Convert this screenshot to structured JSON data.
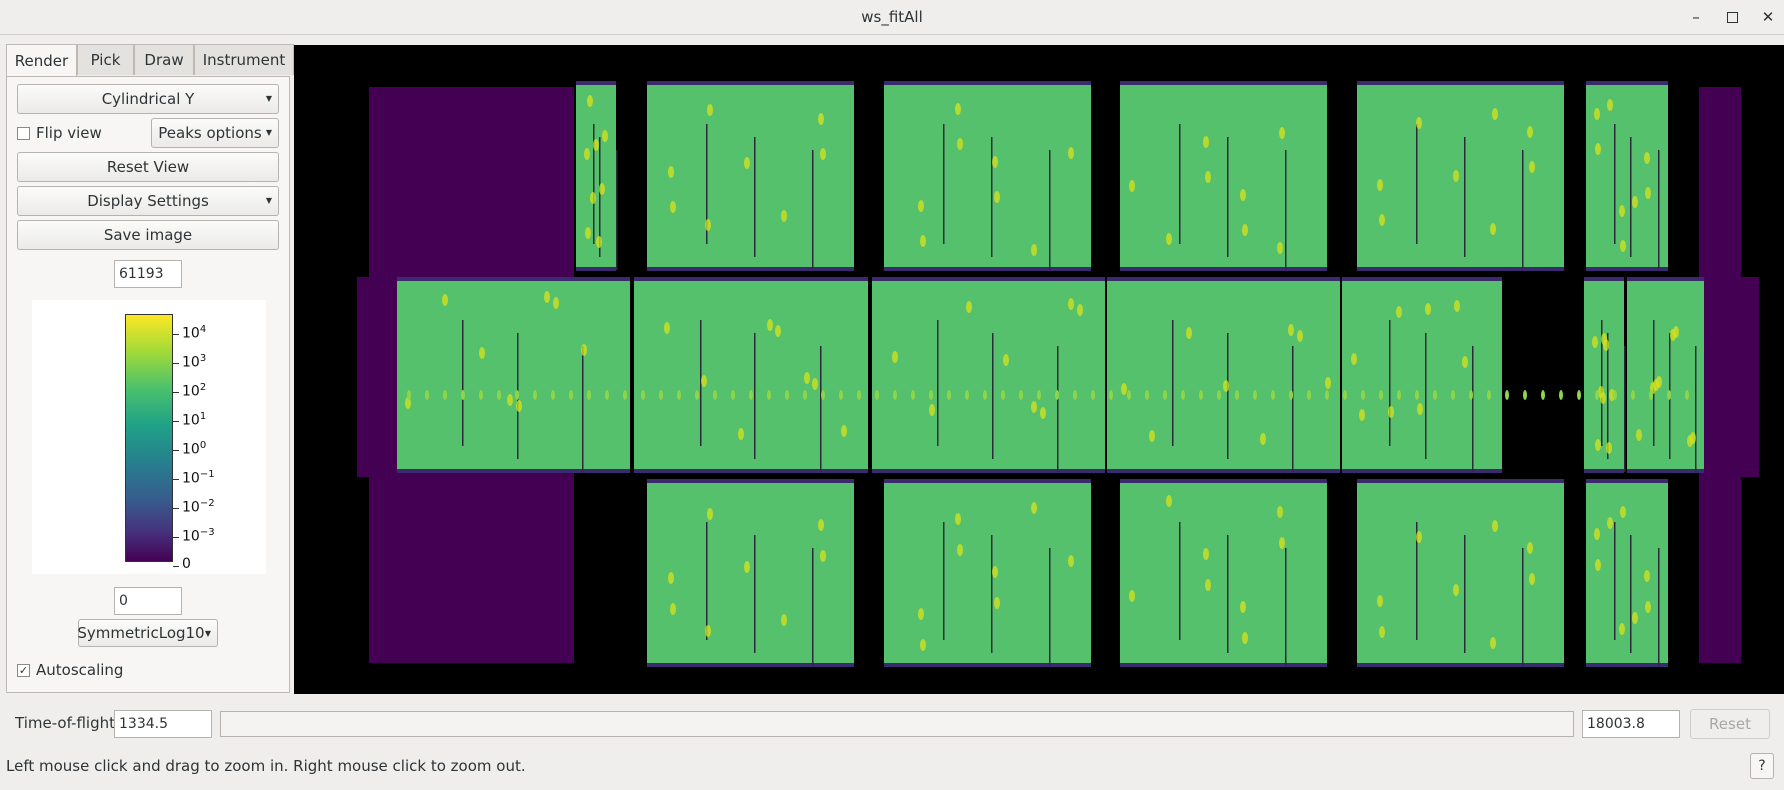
{
  "window": {
    "title": "ws_fitAll",
    "minimize_icon": "minimize-icon",
    "maximize_icon": "maximize-icon",
    "close_icon": "close-icon"
  },
  "tabs": [
    {
      "label": "Render",
      "active": true
    },
    {
      "label": "Pick",
      "active": false
    },
    {
      "label": "Draw",
      "active": false
    },
    {
      "label": "Instrument",
      "active": false
    }
  ],
  "render": {
    "projection_select": "Cylindrical Y",
    "flip_view_label": "Flip view",
    "flip_view_checked": false,
    "peaks_options_label": "Peaks options",
    "reset_view_label": "Reset View",
    "display_settings_label": "Display Settings",
    "save_image_label": "Save image",
    "color_max": "61193",
    "color_min": "0",
    "scale_type": "SymmetricLog10",
    "autoscaling_label": "Autoscaling",
    "autoscaling_checked": true
  },
  "colorbar": {
    "colormap": [
      "#440154",
      "#46327e",
      "#365c8d",
      "#277f8e",
      "#1fa187",
      "#4ac16d",
      "#a0da39",
      "#fde725"
    ],
    "tick_labels": [
      {
        "base": "10",
        "exp": "4"
      },
      {
        "base": "10",
        "exp": "3"
      },
      {
        "base": "10",
        "exp": "2"
      },
      {
        "base": "10",
        "exp": "1"
      },
      {
        "base": "10",
        "exp": "0"
      },
      {
        "base": "10",
        "exp": "−1"
      },
      {
        "base": "10",
        "exp": "−2"
      },
      {
        "base": "10",
        "exp": "−3"
      },
      {
        "base": "0",
        "exp": ""
      }
    ]
  },
  "tof": {
    "label": "Time-of-flight",
    "min": "1334.5",
    "max": "18003.8",
    "reset_label": "Reset"
  },
  "status": {
    "message": "Left mouse click and drag to zoom in. Right mouse click to zoom out.",
    "help_label": "?"
  },
  "colors": {
    "background": "#000000",
    "empty_detector": "#440154",
    "detector_fill": "#55c16c",
    "hot_spot": "#d8e219"
  }
}
